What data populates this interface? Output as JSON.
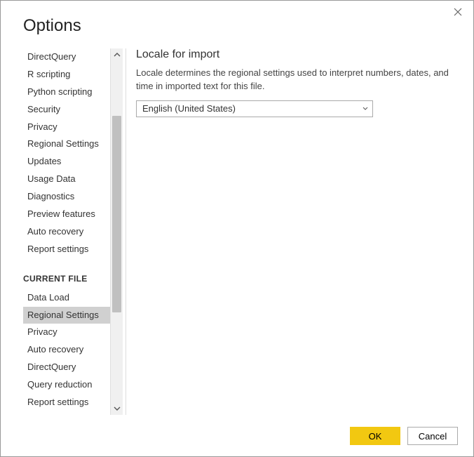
{
  "dialog": {
    "title": "Options",
    "ok_label": "OK",
    "cancel_label": "Cancel"
  },
  "sidebar": {
    "global_items": [
      "DirectQuery",
      "R scripting",
      "Python scripting",
      "Security",
      "Privacy",
      "Regional Settings",
      "Updates",
      "Usage Data",
      "Diagnostics",
      "Preview features",
      "Auto recovery",
      "Report settings"
    ],
    "group_label": "CURRENT FILE",
    "file_items": [
      "Data Load",
      "Regional Settings",
      "Privacy",
      "Auto recovery",
      "DirectQuery",
      "Query reduction",
      "Report settings"
    ],
    "selected_file_index": 1
  },
  "main": {
    "heading": "Locale for import",
    "description": "Locale determines the regional settings used to interpret numbers, dates, and time in imported text for this file.",
    "selected_locale": "English (United States)"
  }
}
